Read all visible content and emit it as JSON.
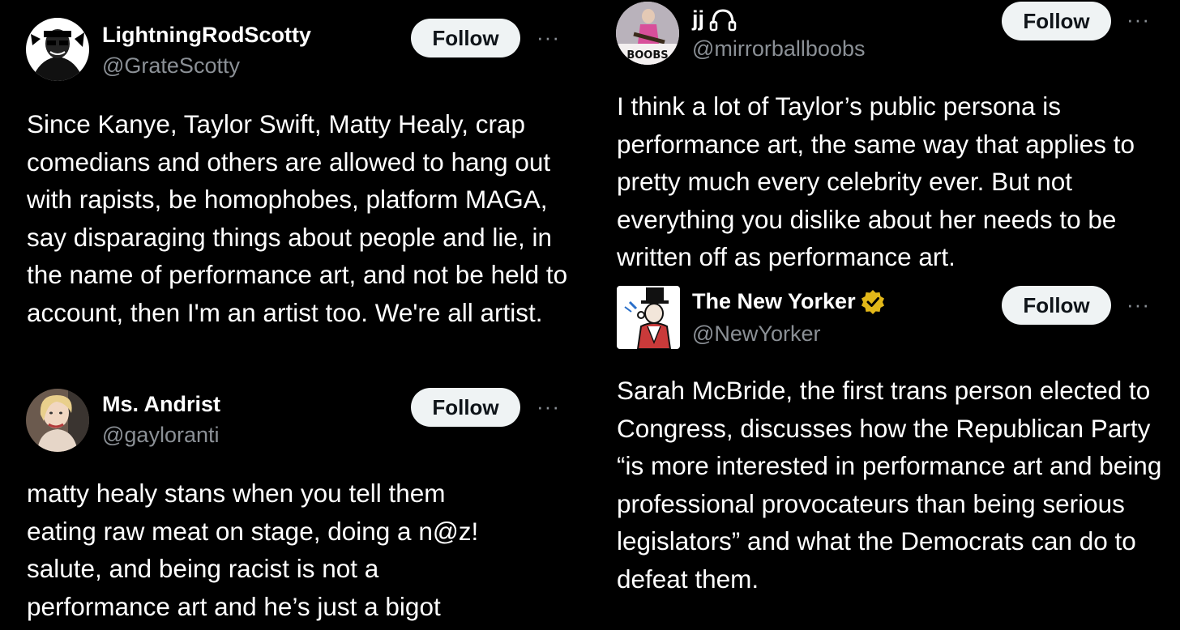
{
  "tweets": [
    {
      "display_name": "LightningRodScotty",
      "handle": "@GrateScotty",
      "follow_label": "Follow",
      "more_label": "···",
      "avatar_icon": "person-with-sunglasses-avatar",
      "text": "Since Kanye, Taylor Swift, Matty Healy, crap comedians and others are allowed to hang out with rapists, be homophobes, platform MAGA, say disparaging things about people and lie, in the name of performance art, and not be held to account, then I'm an artist too. We're all artist."
    },
    {
      "display_name": "Ms. Andrist",
      "handle": "@gayloranti",
      "follow_label": "Follow",
      "more_label": "···",
      "avatar_icon": "blonde-woman-avatar",
      "text": "matty healy stans when you tell them eating raw meat on stage, doing a n@z! salute, and being racist is not a performance art and he’s just a bigot"
    },
    {
      "display_name": "jj",
      "handle": "@mirrorballboobs",
      "follow_label": "Follow",
      "more_label": "···",
      "avatar_icon": "performer-with-guitar-avatar",
      "avatar_caption": "BOOBS",
      "name_icon": "headphones-icon",
      "text": "I think a lot of Taylor’s public persona is performance art, the same way that applies to pretty much every celebrity ever. But not everything you dislike about her needs to be written off as performance art."
    },
    {
      "display_name": "The New Yorker",
      "handle": "@NewYorker",
      "follow_label": "Follow",
      "more_label": "···",
      "avatar_icon": "eustace-tilley-avatar",
      "badge_icon": "verified-gold-badge-icon",
      "text": "Sarah McBride, the first trans person elected to Congress, discusses how the Republican Party “is more interested in performance art and being professional provocateurs than being serious legislators” and what the Democrats can do to defeat them."
    }
  ],
  "colors": {
    "background": "#000000",
    "text": "#ffffff",
    "secondary_text": "#8b9096",
    "follow_bg": "#eff3f4",
    "follow_text": "#0f1419",
    "verified_gold": "#e2b719"
  }
}
